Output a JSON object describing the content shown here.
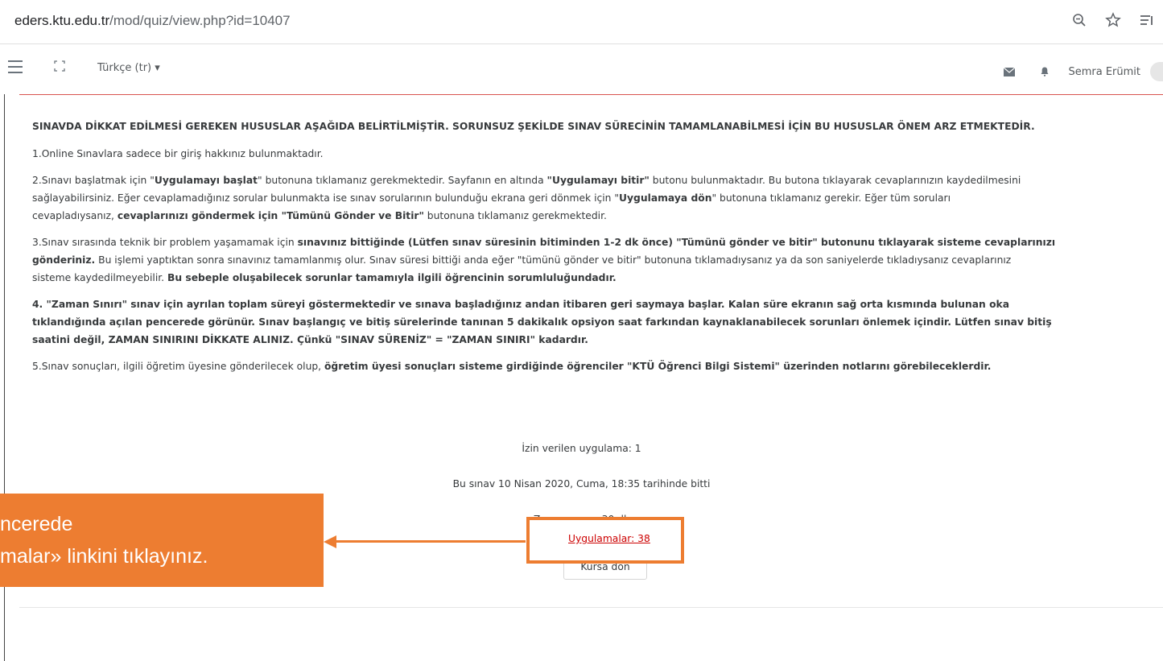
{
  "browser": {
    "url_host": "eders.ktu.edu.tr",
    "url_path": "/mod/quiz/view.php?id=10407",
    "icons": [
      "zoom-out-icon",
      "star-icon",
      "reading-list-icon"
    ]
  },
  "navbar": {
    "language": "Türkçe (tr) ▾",
    "user_name": "Semra Erümit",
    "accent_color": "#d9534f"
  },
  "intro": {
    "heading": "SINAVDA DİKKAT EDİLMESİ GEREKEN HUSUSLAR AŞAĞIDA BELİRTİLMİŞTİR. SORUNSUZ ŞEKİLDE SINAV SÜRECİNİN TAMAMLANABİLMESİ İÇİN BU HUSUSLAR ÖNEM ARZ ETMEKTEDİR.",
    "item1": "1.Online Sınavlara sadece bir giriş hakkınız bulunmaktadır.",
    "item2": [
      {
        "t": "2.Sınavı başlatmak için \"",
        "b": false
      },
      {
        "t": "Uygulamayı başlat",
        "b": true
      },
      {
        "t": "\" butonuna tıklamanız gerekmektedir. Sayfanın en altında ",
        "b": false
      },
      {
        "t": "\"Uygulamayı bitir\"",
        "b": true
      },
      {
        "t": " butonu bulunmaktadır. Bu butona tıklayarak cevaplarınızın kaydedilmesini",
        "b": false
      },
      {
        "br": true
      },
      {
        "t": "sağlayabilirsiniz. Eğer cevaplamadığınız sorular bulunmakta ise sınav sorularının bulunduğu ekrana geri dönmek için \"",
        "b": false
      },
      {
        "t": "Uygulamaya dön",
        "b": true
      },
      {
        "t": "\" butonuna tıklamanız gerekir. Eğer tüm soruları",
        "b": false
      },
      {
        "br": true
      },
      {
        "t": "cevapladıysanız, ",
        "b": false
      },
      {
        "t": "cevaplarınızı göndermek için \"Tümünü Gönder ve Bitir\"",
        "b": true
      },
      {
        "t": " butonuna tıklamanız gerekmektedir.",
        "b": false
      }
    ],
    "item3": [
      {
        "t": "3.Sınav sırasında teknik bir problem yaşamamak için ",
        "b": false
      },
      {
        "t": "sınavınız bittiğinde (Lütfen sınav süresinin bitiminden 1-2 dk önce) \"Tümünü gönder ve bitir\" butonunu tıklayarak sisteme cevaplarınızı",
        "b": true
      },
      {
        "br": true
      },
      {
        "t": "gönderiniz.",
        "b": true
      },
      {
        "t": " Bu işlemi yaptıktan sonra sınavınız tamamlanmış olur. Sınav süresi bittiği anda eğer \"tümünü gönder ve bitir\" butonuna tıklamadıysanız ya da son saniyelerde tıkladıysanız cevaplarınız",
        "b": false
      },
      {
        "br": true
      },
      {
        "t": "sisteme kaydedilmeyebilir.  ",
        "b": false
      },
      {
        "t": "Bu sebeple oluşabilecek sorunlar tamamıyla ilgili öğrencinin sorumluluğundadır.",
        "b": true
      }
    ],
    "item4": [
      {
        "t": "4. \"Zaman Sınırı\" sınav için ayrılan toplam süreyi göstermektedir ve sınava başladığınız andan itibaren geri saymaya başlar. Kalan süre ekranın sağ orta kısmında bulunan oka",
        "b": true
      },
      {
        "br": true
      },
      {
        "t": "tıklandığında açılan pencerede görünür. Sınav başlangıç ve bitiş sürelerinde tanınan 5 dakikalık opsiyon saat farkından kaynaklanabilecek sorunları önlemek içindir. Lütfen sınav bitiş",
        "b": true
      },
      {
        "br": true
      },
      {
        "t": "saatini değil, ZAMAN SINIRINI DİKKATE ALINIZ. Çünkü \"SINAV SÜRENİZ\" = \"ZAMAN SINIRI\" kadardır.",
        "b": true
      }
    ],
    "item5": [
      {
        "t": "5.Sınav sonuçları, ilgili öğretim üyesine gönderilecek olup, ",
        "b": false
      },
      {
        "t": "öğretim üyesi sonuçları sisteme girdiğinde öğrenciler \"KTÜ Öğrenci Bilgi Sistemi\" üzerinden notlarını görebileceklerdir.",
        "b": true
      }
    ]
  },
  "quiz_info": {
    "allowed": "İzin verilen uygulama: 1",
    "closed": "Bu sınav 10 Nisan 2020, Cuma, 18:35 tarihinde bitti",
    "time_limit": "Zaman sınırı: 30 dk",
    "attempts_link": "Uygulamalar: 38",
    "back_button": "Kursa dön"
  },
  "callout": {
    "line1": "ncerede",
    "line2": "malar» linkini tıklayınız.",
    "color": "#ed7d31"
  }
}
